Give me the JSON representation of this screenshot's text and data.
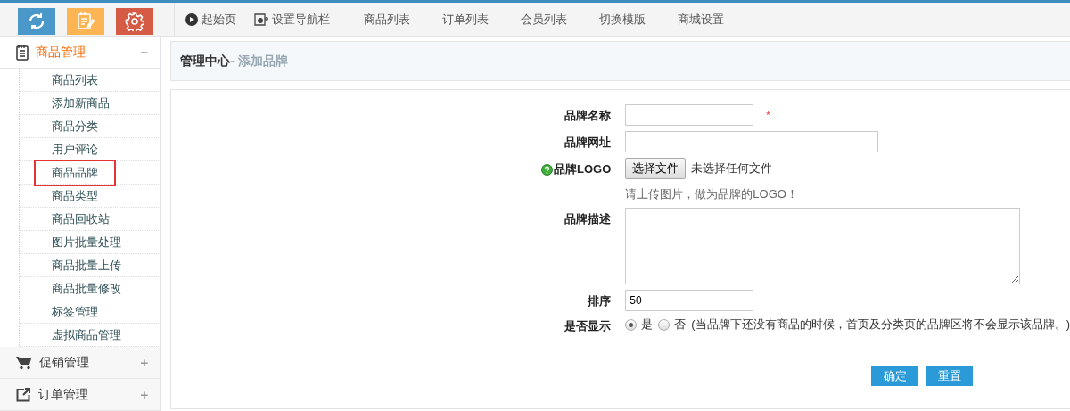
{
  "toolbar": {
    "buttons": [
      {
        "kind": "refresh",
        "color": "#4a98c9"
      },
      {
        "kind": "notes",
        "color": "#fdb452"
      },
      {
        "kind": "settings",
        "color": "#d55b45"
      }
    ]
  },
  "topnav": {
    "items": [
      {
        "kind": "play",
        "label": "起始页"
      },
      {
        "kind": "config",
        "label": "设置导航栏"
      },
      {
        "kind": "text",
        "label": "商品列表"
      },
      {
        "kind": "text",
        "label": "订单列表"
      },
      {
        "kind": "text",
        "label": "会员列表"
      },
      {
        "kind": "text",
        "label": "切换模版"
      },
      {
        "kind": "text",
        "label": "商城设置"
      }
    ]
  },
  "sidebar": {
    "groups": [
      {
        "kind": "notes",
        "label": "商品管理",
        "expanded": true,
        "toggle": "−",
        "items": [
          {
            "label": "商品列表",
            "highlighted": false
          },
          {
            "label": "添加新商品",
            "highlighted": false
          },
          {
            "label": "商品分类",
            "highlighted": false
          },
          {
            "label": "用户评论",
            "highlighted": false
          },
          {
            "label": "商品品牌",
            "highlighted": true
          },
          {
            "label": "商品类型",
            "highlighted": false
          },
          {
            "label": "商品回收站",
            "highlighted": false
          },
          {
            "label": "图片批量处理",
            "highlighted": false
          },
          {
            "label": "商品批量上传",
            "highlighted": false
          },
          {
            "label": "商品批量修改",
            "highlighted": false
          },
          {
            "label": "标签管理",
            "highlighted": false
          },
          {
            "label": "虚拟商品管理",
            "highlighted": false
          }
        ]
      },
      {
        "kind": "cart",
        "label": "促销管理",
        "expanded": false,
        "toggle": "+"
      },
      {
        "kind": "export",
        "label": "订单管理",
        "expanded": false,
        "toggle": "+"
      }
    ]
  },
  "breadcrumb": {
    "title": "管理中心",
    "subtitle": "- 添加品牌"
  },
  "form": {
    "fields": [
      {
        "kind": "text",
        "label": "品牌名称",
        "required_mark": "*"
      },
      {
        "kind": "url",
        "label": "品牌网址"
      },
      {
        "kind": "file",
        "label": "品牌LOGO",
        "button": "选择文件",
        "status": "未选择任何文件",
        "hint": "请上传图片，做为品牌的LOGO！"
      },
      {
        "kind": "textarea",
        "label": "品牌描述"
      },
      {
        "kind": "text",
        "label": "排序",
        "value": "50"
      },
      {
        "kind": "radio",
        "label": "是否显示",
        "options": [
          {
            "label": "是",
            "selected": true
          },
          {
            "label": "否",
            "selected": false
          }
        ],
        "note": "(当品牌下还没有商品的时候，首页及分类页的品牌区将不会显示该品牌。)"
      }
    ],
    "buttons": [
      "确定",
      "重置"
    ]
  }
}
